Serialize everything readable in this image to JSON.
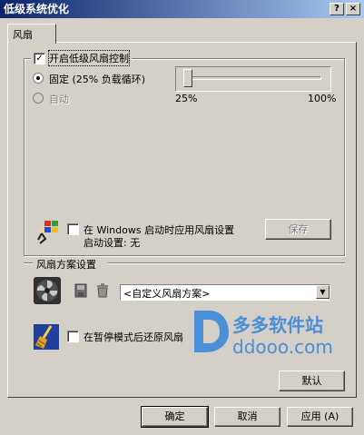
{
  "window": {
    "title": "低级系统优化",
    "help_button": "?",
    "close_button": "×"
  },
  "tabs": [
    {
      "label": "风扇"
    }
  ],
  "fan_control": {
    "enable_label": "开启低级风扇控制",
    "enable_checked": true,
    "fixed_label": "固定  (25% 负载循环)",
    "auto_label": "自动",
    "slider": {
      "min_label": "25%",
      "max_label": "100%",
      "value_percent": 0
    }
  },
  "startup": {
    "apply_label": "在 Windows 启动时应用风扇设置",
    "status_label": "启动设置:  无",
    "save_button": "保存"
  },
  "scheme": {
    "section_title": "风扇方案设置",
    "selected": "<自定义风扇方案>",
    "restore_label": "在暂停模式后还原风扇"
  },
  "watermark": {
    "name": "多多软件站",
    "url": "ddooo.com"
  },
  "buttons": {
    "default": "默认",
    "ok": "确定",
    "cancel": "取消",
    "apply": "应用 (A)"
  },
  "colors": {
    "title_start": "#0a246a",
    "title_end": "#a6caf0",
    "face": "#d4d0c8",
    "watermark": "#4a8fd8"
  }
}
